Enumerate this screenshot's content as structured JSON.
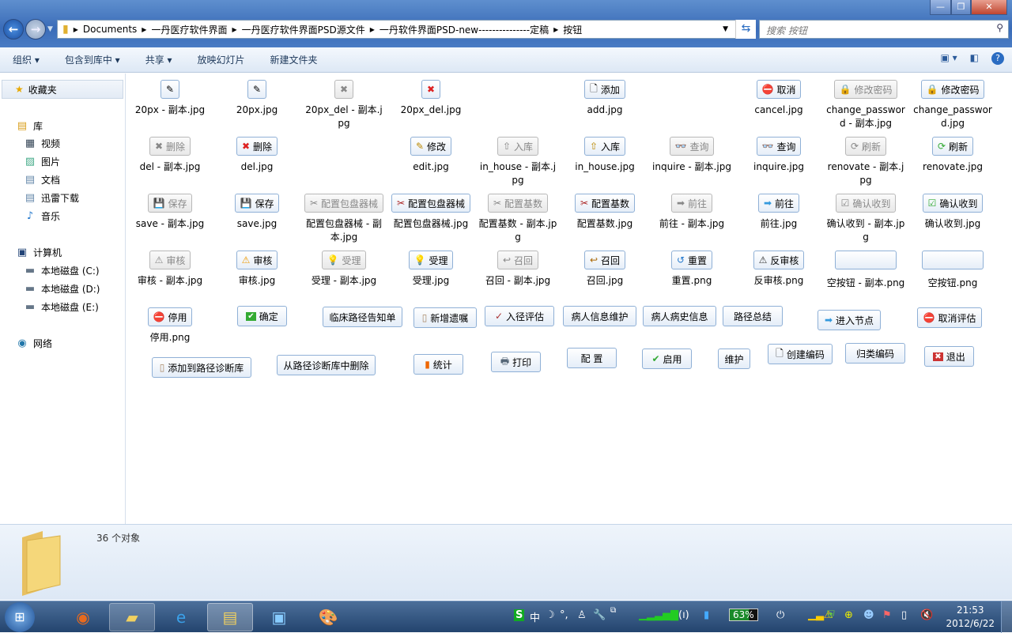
{
  "address": {
    "segments": [
      "Documents",
      "一丹医疗软件界面",
      "一丹医疗软件界面PSD源文件",
      "一丹软件界面PSD-new---------------定稿",
      "按钮"
    ]
  },
  "search": {
    "placeholder": "搜索 按钮"
  },
  "toolbar": {
    "items": [
      "组织 ▾",
      "包含到库中 ▾",
      "共享 ▾",
      "放映幻灯片",
      "新建文件夹"
    ]
  },
  "sidebar": {
    "favorites": "收藏夹",
    "library": "库",
    "lib_items": [
      "视频",
      "图片",
      "文档",
      "迅雷下载",
      "音乐"
    ],
    "computer": "计算机",
    "drives": [
      "本地磁盘 (C:)",
      "本地磁盘 (D:)",
      "本地磁盘 (E:)"
    ],
    "network": "网络"
  },
  "grid": [
    [
      {
        "t": "",
        "f": "20px - 副本.jpg",
        "i": "✎",
        "d": false
      },
      {
        "t": "",
        "f": "20px.jpg",
        "i": "✎"
      },
      {
        "t": "",
        "f": "20px_del - 副本.jpg",
        "i": "✖",
        "d": true
      },
      {
        "t": "",
        "f": "20px_del.jpg",
        "i": "✖",
        "c": "#d22"
      },
      null,
      {
        "t": "添加",
        "f": "add.jpg",
        "i": "🗋"
      },
      null,
      {
        "t": "取消",
        "f": "cancel.jpg",
        "i": "⛔",
        "c": "#c22"
      },
      {
        "t": "修改密码",
        "f": "change_password - 副本.jpg",
        "i": "🔒",
        "d": true
      },
      {
        "t": "修改密码",
        "f": "change_password.jpg",
        "i": "🔒",
        "c": "#b80"
      }
    ],
    [
      {
        "t": "删除",
        "f": "del - 副本.jpg",
        "i": "✖",
        "d": true
      },
      {
        "t": "删除",
        "f": "del.jpg",
        "i": "✖",
        "c": "#d22"
      },
      null,
      {
        "t": "修改",
        "f": "edit.jpg",
        "i": "✎",
        "c": "#b80"
      },
      {
        "t": "入库",
        "f": "in_house - 副本.jpg",
        "i": "⇧",
        "d": true
      },
      {
        "t": "入库",
        "f": "in_house.jpg",
        "i": "⇧",
        "c": "#b80"
      },
      {
        "t": "查询",
        "f": "inquire - 副本.jpg",
        "i": "👓",
        "d": true
      },
      {
        "t": "查询",
        "f": "inquire.jpg",
        "i": "👓",
        "c": "#247"
      },
      {
        "t": "刷新",
        "f": "renovate - 副本.jpg",
        "i": "⟳",
        "d": true
      },
      {
        "t": "刷新",
        "f": "renovate.jpg",
        "i": "⟳",
        "c": "#3a3"
      }
    ],
    [
      {
        "t": "保存",
        "f": "save - 副本.jpg",
        "i": "💾",
        "d": true
      },
      {
        "t": "保存",
        "f": "save.jpg",
        "i": "💾",
        "c": "#236"
      },
      {
        "t": "配置包盘器械",
        "f": "配置包盘器械 - 副本.jpg",
        "i": "✂",
        "d": true
      },
      {
        "t": "配置包盘器械",
        "f": "配置包盘器械.jpg",
        "i": "✂",
        "c": "#a22"
      },
      {
        "t": "配置基数",
        "f": "配置基数 - 副本.jpg",
        "i": "✂",
        "d": true
      },
      {
        "t": "配置基数",
        "f": "配置基数.jpg",
        "i": "✂",
        "c": "#a22"
      },
      {
        "t": "前往",
        "f": "前往 - 副本.jpg",
        "i": "➡",
        "d": true
      },
      {
        "t": "前往",
        "f": "前往.jpg",
        "i": "➡",
        "c": "#39d"
      },
      {
        "t": "确认收到",
        "f": "确认收到 - 副本.jpg",
        "i": "☑",
        "d": true
      },
      {
        "t": "确认收到",
        "f": "确认收到.jpg",
        "i": "☑",
        "c": "#3a3"
      }
    ],
    [
      {
        "t": "审核",
        "f": "审核 - 副本.jpg",
        "i": "⚠",
        "d": true
      },
      {
        "t": "审核",
        "f": "审核.jpg",
        "i": "⚠",
        "c": "#e90"
      },
      {
        "t": "受理",
        "f": "受理 - 副本.jpg",
        "i": "💡",
        "d": true
      },
      {
        "t": "受理",
        "f": "受理.jpg",
        "i": "💡",
        "c": "#e90"
      },
      {
        "t": "召回",
        "f": "召回 - 副本.jpg",
        "i": "↩",
        "d": true
      },
      {
        "t": "召回",
        "f": "召回.jpg",
        "i": "↩",
        "c": "#a60"
      },
      {
        "t": "重置",
        "f": "重置.png",
        "i": "↺",
        "c": "#27c"
      },
      {
        "t": "反审核",
        "f": "反审核.png",
        "i": "⚠",
        "c": "#333"
      },
      {
        "t": "",
        "f": "空按钮 - 副本.png",
        "i": ""
      },
      {
        "t": "",
        "f": "空按钮.png",
        "i": ""
      }
    ],
    [
      {
        "t": "停用",
        "f": "停用.png",
        "i": "⛔",
        "c": "#c22"
      }
    ]
  ],
  "sheet_buttons": [
    "确定",
    "临床路径告知单",
    "新增遗嘱",
    "入径评估",
    "病人信息维护",
    "病人病史信息",
    "路径总结",
    "进入节点",
    "取消评估",
    "添加到路径诊断库",
    "从路径诊断库中删除",
    "统计",
    "打印",
    "配 置",
    "启用",
    "维护",
    "创建编码",
    "归类编码",
    "退出"
  ],
  "details": {
    "count": "36 个对象"
  },
  "tray": {
    "battery": "63%",
    "time": "21:53",
    "date": "2012/6/22"
  }
}
